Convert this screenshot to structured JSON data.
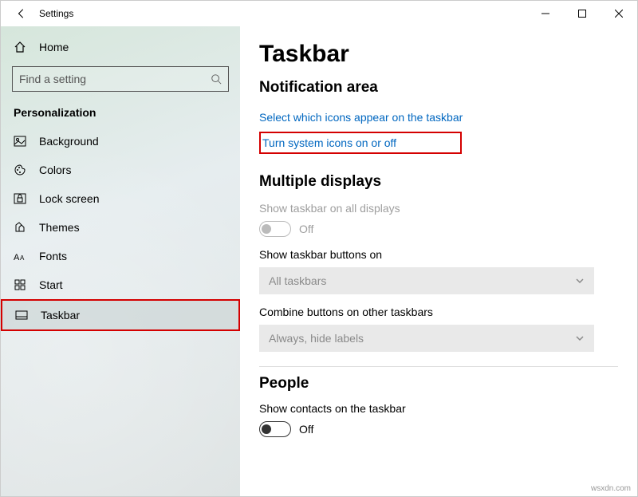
{
  "window": {
    "title": "Settings"
  },
  "sidebar": {
    "home": "Home",
    "search_placeholder": "Find a setting",
    "category": "Personalization",
    "items": [
      {
        "label": "Background"
      },
      {
        "label": "Colors"
      },
      {
        "label": "Lock screen"
      },
      {
        "label": "Themes"
      },
      {
        "label": "Fonts"
      },
      {
        "label": "Start"
      },
      {
        "label": "Taskbar"
      }
    ]
  },
  "main": {
    "title": "Taskbar",
    "notif_header": "Notification area",
    "link1": "Select which icons appear on the taskbar",
    "link2": "Turn system icons on or off",
    "multi_header": "Multiple displays",
    "show_all_label": "Show taskbar on all displays",
    "show_all_state": "Off",
    "show_buttons_label": "Show taskbar buttons on",
    "show_buttons_value": "All taskbars",
    "combine_label": "Combine buttons on other taskbars",
    "combine_value": "Always, hide labels",
    "people_header": "People",
    "contacts_label": "Show contacts on the taskbar",
    "contacts_state": "Off"
  },
  "watermark": "wsxdn.com"
}
